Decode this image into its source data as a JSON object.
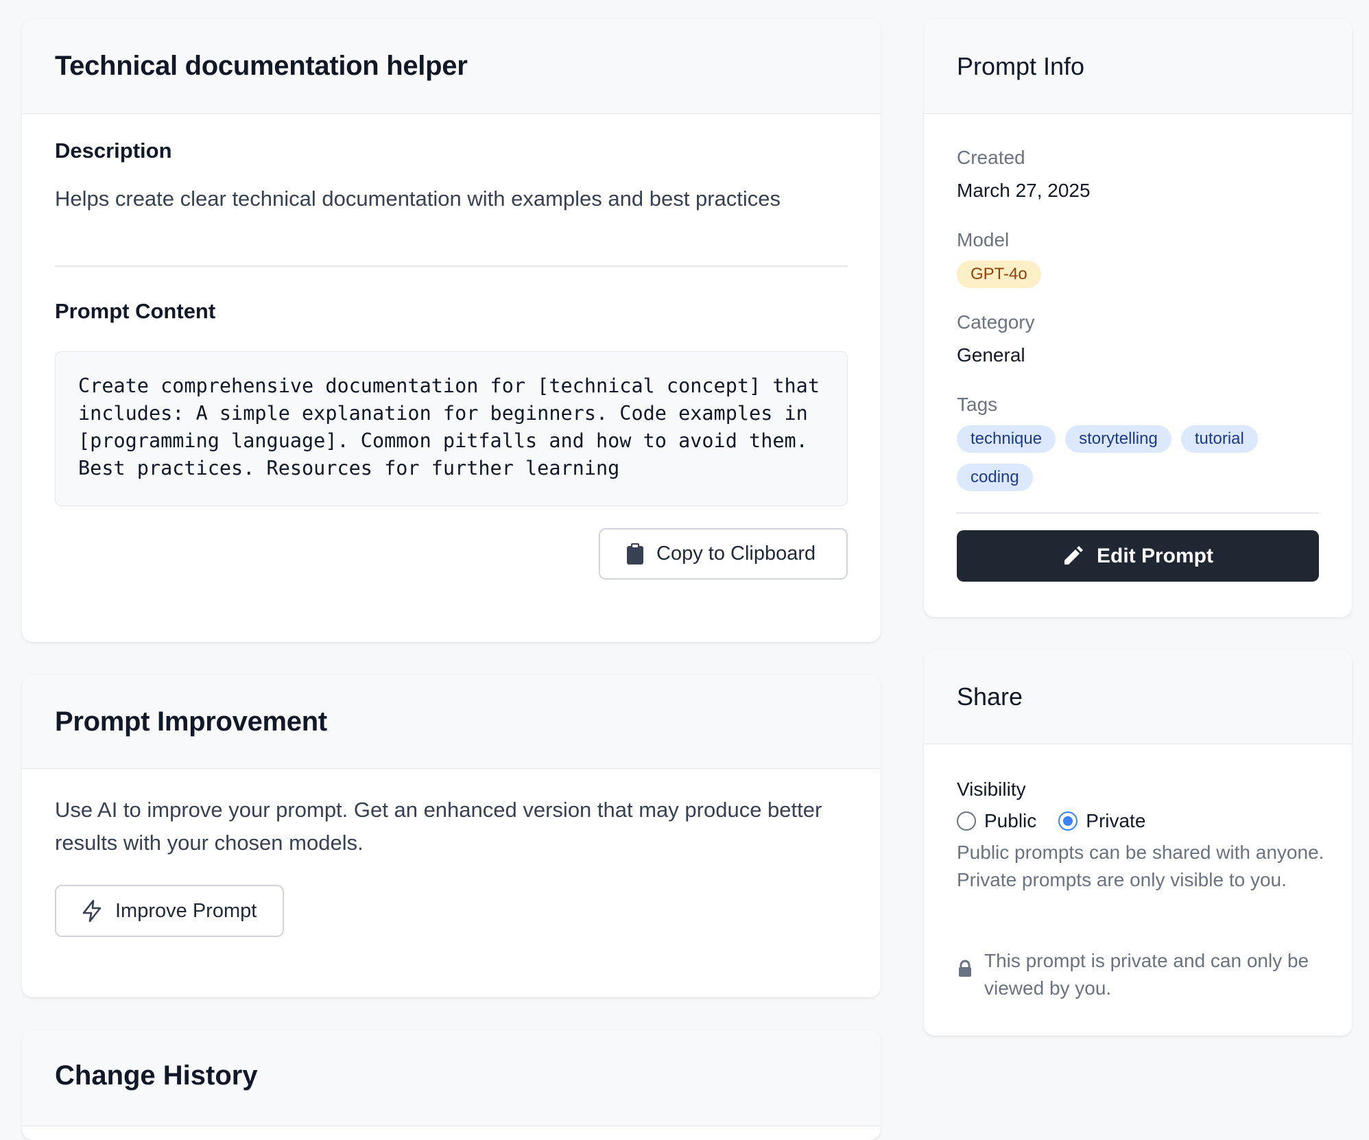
{
  "main": {
    "title": "Technical documentation helper",
    "description_label": "Description",
    "description": "Helps create clear technical documentation with examples and best practices",
    "content_label": "Prompt Content",
    "content": "Create comprehensive documentation for [technical concept] that includes: A simple explanation for beginners. Code examples in [programming language]. Common pitfalls and how to avoid them. Best practices. Resources for further learning",
    "copy_button": "Copy to Clipboard"
  },
  "improvement": {
    "title": "Prompt Improvement",
    "text": "Use AI to improve your prompt. Get an enhanced version that may produce better results with your chosen models.",
    "button": "Improve Prompt"
  },
  "history": {
    "title": "Change History"
  },
  "info": {
    "title": "Prompt Info",
    "created_label": "Created",
    "created_value": "March 27, 2025",
    "model_label": "Model",
    "model_value": "GPT-4o",
    "category_label": "Category",
    "category_value": "General",
    "tags_label": "Tags",
    "tags": [
      "technique",
      "storytelling",
      "tutorial",
      "coding"
    ],
    "edit_button": "Edit Prompt"
  },
  "share": {
    "title": "Share",
    "visibility_label": "Visibility",
    "options": [
      "Public",
      "Private"
    ],
    "selected": "Private",
    "help": "Public prompts can be shared with anyone. Private prompts are only visible to you.",
    "private_note": "This prompt is private and can only be viewed by you."
  },
  "colors": {
    "accent": "#3b82f6",
    "dark_button": "#1f2733",
    "model_pill_bg": "#fdf0c6",
    "tag_pill_bg": "#dbe8fd"
  }
}
